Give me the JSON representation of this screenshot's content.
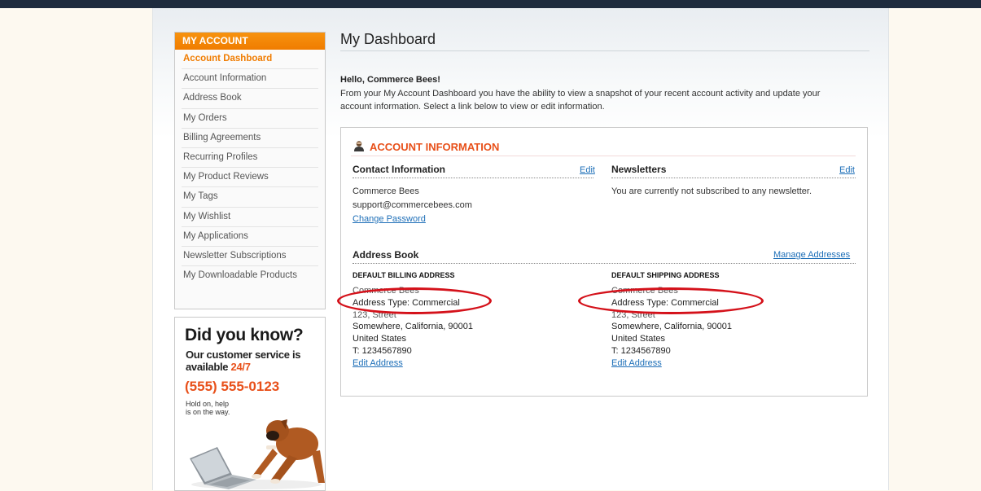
{
  "sidebar": {
    "header": "MY ACCOUNT",
    "items": [
      {
        "label": "Account Dashboard",
        "active": true
      },
      {
        "label": "Account Information"
      },
      {
        "label": "Address Book"
      },
      {
        "label": "My Orders"
      },
      {
        "label": "Billing Agreements"
      },
      {
        "label": "Recurring Profiles"
      },
      {
        "label": "My Product Reviews"
      },
      {
        "label": "My Tags"
      },
      {
        "label": "My Wishlist"
      },
      {
        "label": "My Applications"
      },
      {
        "label": "Newsletter Subscriptions"
      },
      {
        "label": "My Downloadable Products"
      }
    ]
  },
  "promo": {
    "title": "Did you know?",
    "line1": "Our customer service is",
    "line2_prefix": "available ",
    "line2_highlight": "24/7",
    "phone": "(555) 555-0123",
    "subtext": "Hold on, help is on the way."
  },
  "main": {
    "title": "My Dashboard",
    "greeting": "Hello, Commerce Bees!",
    "intro": "From your My Account Dashboard you have the ability to view a snapshot of your recent account activity and update your account information. Select a link below to view or edit information."
  },
  "account_info": {
    "heading": "ACCOUNT INFORMATION",
    "contact": {
      "title": "Contact Information",
      "edit": "Edit",
      "name": "Commerce Bees",
      "email": "support@commercebees.com",
      "change_password": "Change Password"
    },
    "newsletters": {
      "title": "Newsletters",
      "edit": "Edit",
      "text": "You are currently not subscribed to any newsletter."
    },
    "address_book": {
      "title": "Address Book",
      "manage": "Manage Addresses",
      "billing": {
        "heading": "DEFAULT BILLING ADDRESS",
        "name": "Commerce Bees",
        "type": "Address Type: Commercial",
        "street": "123, Street",
        "city": "Somewhere, California, 90001",
        "country": "United States",
        "phone": "T: 1234567890",
        "edit": "Edit Address"
      },
      "shipping": {
        "heading": "DEFAULT SHIPPING ADDRESS",
        "name": "Commerce Bees",
        "type": "Address Type: Commercial",
        "street": "123, Street",
        "city": "Somewhere, California, 90001",
        "country": "United States",
        "phone": "T: 1234567890",
        "edit": "Edit Address"
      }
    }
  },
  "colors": {
    "accent_orange": "#f07c00",
    "heading_orange": "#e8501a",
    "link_blue": "#1e6fb8",
    "annotation_red": "#d4111a"
  },
  "icons": {
    "account": "user-icon"
  }
}
